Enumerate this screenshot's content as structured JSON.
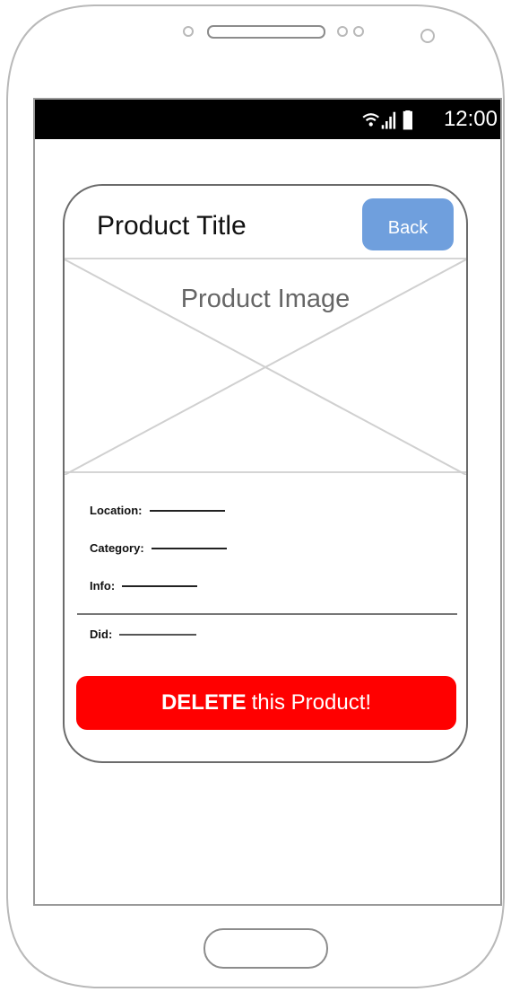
{
  "status_bar": {
    "time": "12:00"
  },
  "card": {
    "title": "Product Title",
    "back_label": "Back",
    "image_placeholder": "Product Image",
    "fields": [
      {
        "label": "Location:"
      },
      {
        "label": "Category:"
      },
      {
        "label": "Info:"
      },
      {
        "label": "Did:"
      }
    ],
    "delete_button": {
      "strong": "DELETE",
      "rest": "this Product!"
    }
  },
  "colors": {
    "back_button": "#6f9fdd",
    "delete_button": "#ff0000",
    "status_bar": "#000000"
  },
  "icons": [
    "wifi-icon",
    "signal-icon",
    "battery-icon"
  ]
}
